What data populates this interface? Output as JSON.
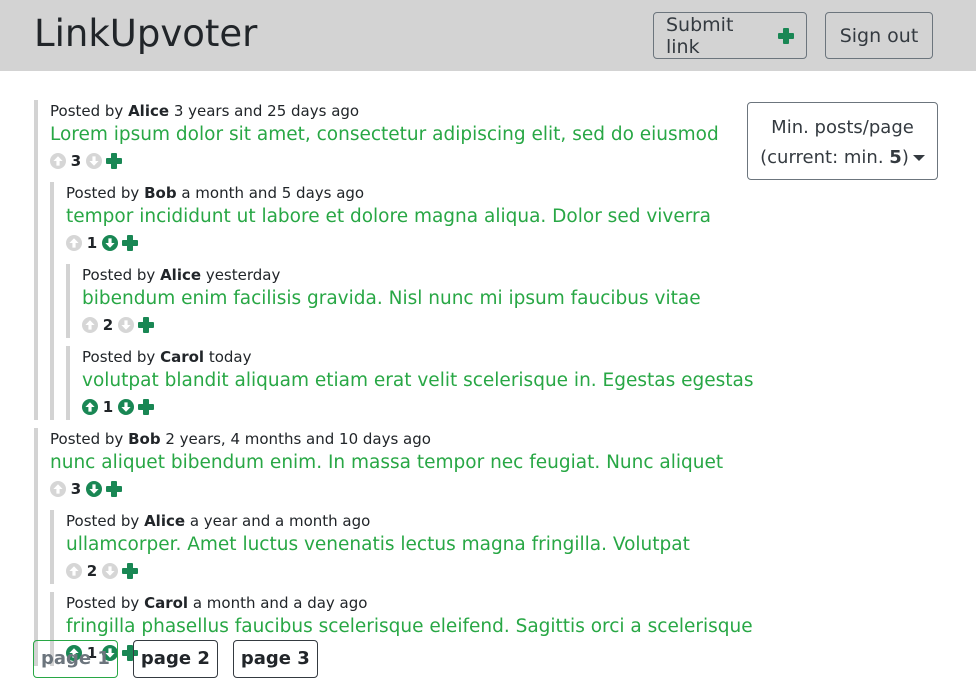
{
  "app": {
    "title": "LinkUpvoter"
  },
  "navbar": {
    "submit_label": "Submit link",
    "signout_label": "Sign out"
  },
  "filter": {
    "line1": "Min. posts/page",
    "line2_prefix": "(current: min. ",
    "line2_value": "5",
    "line2_suffix": ")"
  },
  "posts": [
    {
      "author": "Alice",
      "age": "3 years and 25 days ago",
      "title": "Lorem ipsum dolor sit amet, consectetur adipiscing elit, sed do eiusmod",
      "score": "3",
      "up_active": false,
      "down_active": false,
      "replies": [
        {
          "author": "Bob",
          "age": "a month and 5 days ago",
          "title": "tempor incididunt ut labore et dolore magna aliqua. Dolor sed viverra",
          "score": "1",
          "up_active": false,
          "down_active": true,
          "replies": [
            {
              "author": "Alice",
              "age": "yesterday",
              "title": "bibendum enim facilisis gravida. Nisl nunc mi ipsum faucibus vitae",
              "score": "2",
              "up_active": false,
              "down_active": false
            },
            {
              "author": "Carol",
              "age": "today",
              "title": "volutpat blandit aliquam etiam erat velit scelerisque in. Egestas egestas",
              "score": "1",
              "up_active": true,
              "down_active": true
            }
          ]
        }
      ]
    },
    {
      "author": "Bob",
      "age": "2 years, 4 months and 10 days ago",
      "title": "nunc aliquet bibendum enim. In massa tempor nec feugiat. Nunc aliquet",
      "score": "3",
      "up_active": false,
      "down_active": true,
      "replies": [
        {
          "author": "Alice",
          "age": "a year and a month ago",
          "title": "ullamcorper. Amet luctus venenatis lectus magna fringilla. Volutpat",
          "score": "2",
          "up_active": false,
          "down_active": false
        },
        {
          "author": "Carol",
          "age": "a month and a day ago",
          "title": "fringilla phasellus faucibus scelerisque eleifend. Sagittis orci a scelerisque",
          "score": "1",
          "up_active": true,
          "down_active": true
        }
      ]
    }
  ],
  "labels": {
    "posted_by": "Posted by"
  },
  "pagination": {
    "pages": [
      "page 1",
      "page 2",
      "page 3"
    ],
    "active_index": 0
  },
  "colors": {
    "accent_green": "#28a745",
    "icon_green": "#198754",
    "navbar_bg": "#d3d3d3",
    "inactive_arrow": "#d6d6d6"
  }
}
